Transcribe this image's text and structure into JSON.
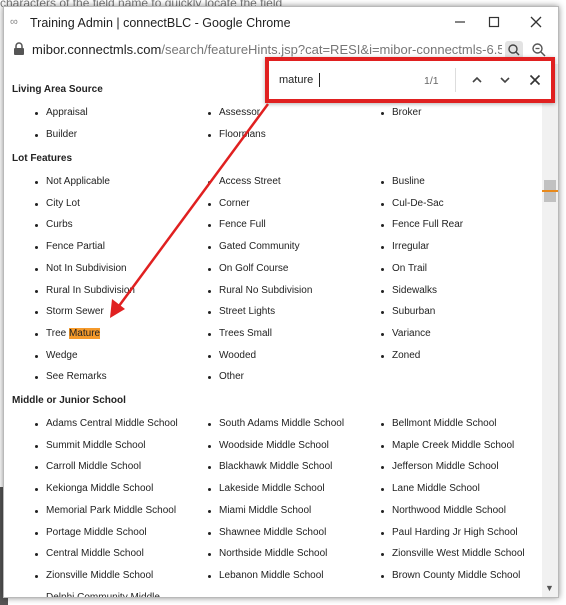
{
  "background": {
    "top_text": "characters of the field name to quickly locate the field"
  },
  "window": {
    "title": "Training Admin | connectBLC - Google Chrome",
    "app_icon": "link-icon",
    "controls": {
      "minimize": "minimize-icon",
      "maximize": "maximize-icon",
      "close": "close-icon"
    }
  },
  "address_bar": {
    "host": "mibor.connectmls.com",
    "path": "/search/featureHints.jsp?cat=RESI&i=mibor-connectmls-6.5...."
  },
  "find_bar": {
    "query": "mature",
    "count": "1/1",
    "highlight_color": "#f59a2b",
    "border_color": "#e02020"
  },
  "sections": [
    {
      "title": "Living Area Source",
      "items": [
        "Appraisal",
        "Assessor",
        "Broker",
        "Builder",
        "Floorplans"
      ]
    },
    {
      "title": "Lot Features",
      "items": [
        "Not Applicable",
        "Access Street",
        "Busline",
        "City Lot",
        "Corner",
        "Cul-De-Sac",
        "Curbs",
        "Fence Full",
        "Fence Full Rear",
        "Fence Partial",
        "Gated Community",
        "Irregular",
        "Not In Subdivision",
        "On Golf Course",
        "On Trail",
        "Rural In Subdivision",
        "Rural No Subdivision",
        "Sidewalks",
        "Storm Sewer",
        "Street Lights",
        "Suburban",
        "Tree Mature",
        "Trees Small",
        "Variance",
        "Wedge",
        "Wooded",
        "Zoned",
        "See Remarks",
        "Other"
      ]
    },
    {
      "title": "Middle or Junior School",
      "items": [
        "Adams Central Middle School",
        "South Adams Middle School",
        "Bellmont Middle School",
        "Summit Middle School",
        "Woodside Middle School",
        "Maple Creek Middle School",
        "Carroll Middle School",
        "Blackhawk Middle School",
        "Jefferson Middle School",
        "Kekionga Middle School",
        "Lakeside Middle School",
        "Lane Middle School",
        "Memorial Park Middle School",
        "Miami Middle School",
        "Northwood Middle School",
        "Portage Middle School",
        "Shawnee Middle School",
        "Paul Harding Jr High School",
        "Central Middle School",
        "Northside Middle School",
        "Zionsville West Middle School",
        "Zionsville Middle School",
        "Lebanon Middle School",
        "Brown County Middle School",
        "Delphi Community Middle"
      ]
    }
  ]
}
